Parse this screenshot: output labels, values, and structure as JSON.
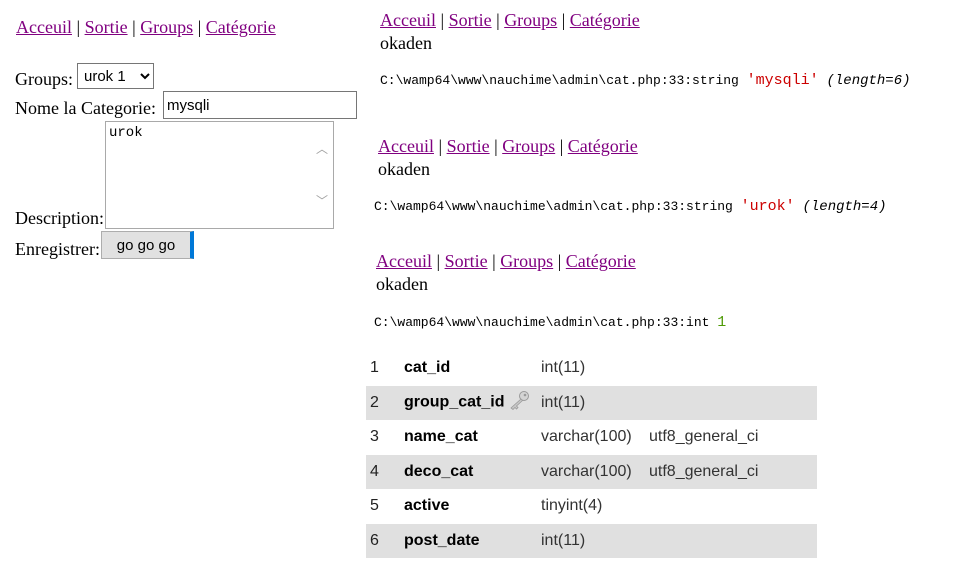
{
  "nav": {
    "acceuil": "Acceuil",
    "sortie": "Sortie",
    "groups": "Groups",
    "categorie": "Catégorie",
    "separator": "|"
  },
  "form": {
    "groups_label": "Groups:",
    "groups_value": "urok 1",
    "name_label": "Nome la Categorie:",
    "name_value": "mysqli",
    "description_label": "Description:",
    "description_value": "urok",
    "submit_label": "Enregistrer:",
    "submit_button": "go go go"
  },
  "output": {
    "okaden": "okaden",
    "dumps": [
      {
        "path": "C:\\wamp64\\www\\nauchime\\admin\\cat.php:33:string",
        "value": "'mysqli'",
        "length": "(length=6)"
      },
      {
        "path": "C:\\wamp64\\www\\nauchime\\admin\\cat.php:33:string",
        "value": "'urok'",
        "length": "(length=4)"
      },
      {
        "path": "C:\\wamp64\\www\\nauchime\\admin\\cat.php:33:int",
        "value": "1"
      }
    ]
  },
  "structure": {
    "rows": [
      {
        "num": "1",
        "name": "cat_id",
        "type": "int(11)",
        "collation": ""
      },
      {
        "num": "2",
        "name": "group_cat_id",
        "type": "int(11)",
        "collation": "",
        "key": "key-icon"
      },
      {
        "num": "3",
        "name": "name_cat",
        "type": "varchar(100)",
        "collation": "utf8_general_ci"
      },
      {
        "num": "4",
        "name": "deco_cat",
        "type": "varchar(100)",
        "collation": "utf8_general_ci"
      },
      {
        "num": "5",
        "name": "active",
        "type": "tinyint(4)",
        "collation": ""
      },
      {
        "num": "6",
        "name": "post_date",
        "type": "int(11)",
        "collation": ""
      }
    ]
  }
}
